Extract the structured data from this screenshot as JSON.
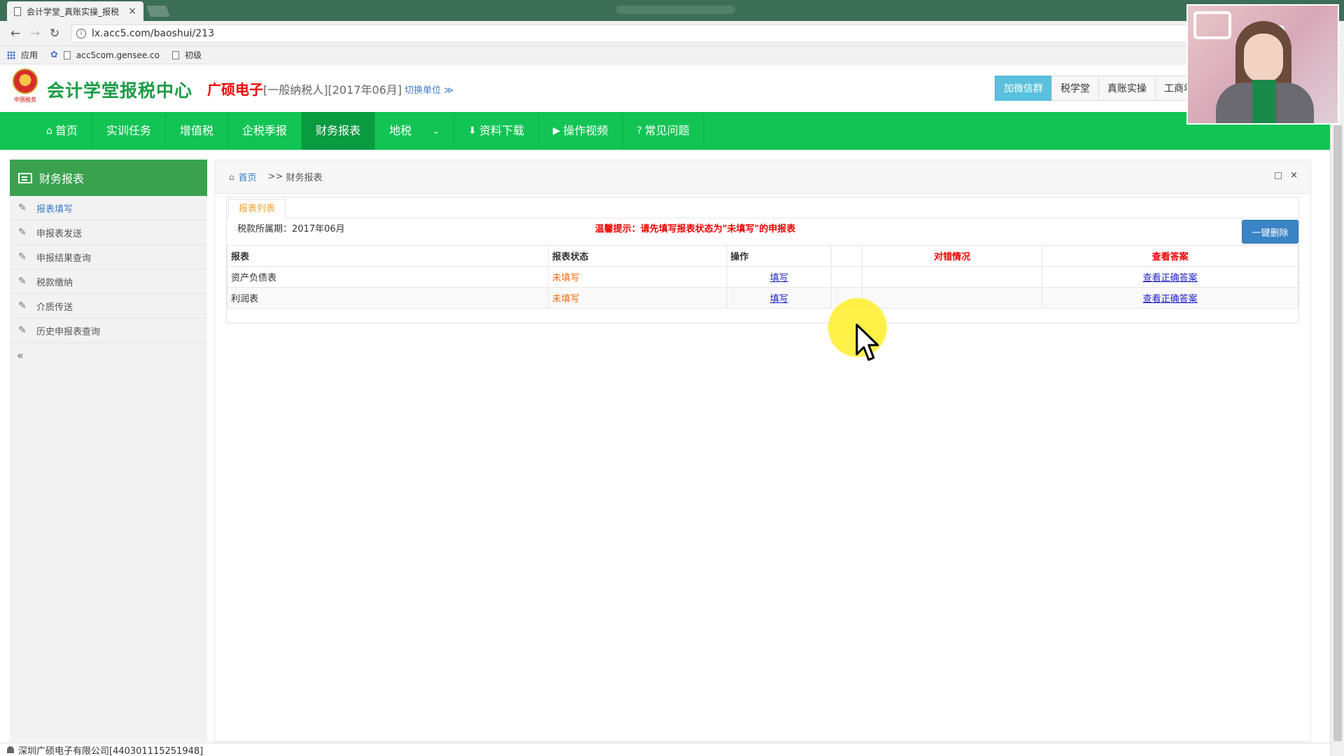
{
  "browser": {
    "tab_title": "会计学堂_真账实操_报税",
    "url": "lx.acc5.com/baoshui/213",
    "bookmarks": [
      {
        "label": "应用"
      },
      {
        "label": "acc5com.gensee.co"
      },
      {
        "label": "初级"
      }
    ]
  },
  "header": {
    "emblem_text": "中国税务",
    "site_title": "会计学堂报税中心",
    "company": "广硕电子",
    "taxpayer_info": "[一般纳税人][2017年06月]",
    "switch_unit": "切换单位 ≫",
    "top_links": [
      "加微信群",
      "税学堂",
      "真账实操",
      "工商年"
    ]
  },
  "nav": {
    "items": [
      {
        "label": "首页",
        "icon": "home-icon",
        "glyph": "⌂"
      },
      {
        "label": "实训任务"
      },
      {
        "label": "增值税"
      },
      {
        "label": "企税季报"
      },
      {
        "label": "财务报表",
        "active": true
      },
      {
        "label": "地税",
        "caret": "⌄"
      },
      {
        "label": "资料下载",
        "icon": "download-icon",
        "glyph": "⬇"
      },
      {
        "label": "操作视频",
        "icon": "play-icon",
        "glyph": "▶"
      },
      {
        "label": "常见问题",
        "icon": "question-icon",
        "glyph": "?"
      }
    ]
  },
  "sidebar": {
    "title": "财务报表",
    "items": [
      {
        "label": "报表填写",
        "active": true
      },
      {
        "label": "申报表发送"
      },
      {
        "label": "申报结果查询"
      },
      {
        "label": "税款缴纳"
      },
      {
        "label": "介质传送"
      },
      {
        "label": "历史申报表查询"
      }
    ],
    "collapse_glyph": "«"
  },
  "breadcrumb": {
    "home": "首页",
    "separator": ">>",
    "current": "财务报表"
  },
  "panel": {
    "tab_label": "报表列表",
    "period": "税款所属期：2017年06月",
    "tip": "温馨提示：请先填写报表状态为\"未填写\"的申报表",
    "delete_button": "一键删除",
    "columns": [
      "报表",
      "报表状态",
      "操作",
      "",
      "对错情况",
      "查看答案"
    ],
    "rows": [
      {
        "name": "资产负债表",
        "status": "未填写",
        "action": "填写",
        "blank": "",
        "result": "",
        "answer": "查看正确答案"
      },
      {
        "name": "利润表",
        "status": "未填写",
        "action": "填写",
        "blank": "",
        "result": "",
        "answer": "查看正确答案"
      }
    ]
  },
  "footer": {
    "company": "深圳广硕电子有限公司[440301115251948]"
  },
  "colors": {
    "nav_green": "#11c454",
    "nav_active": "#0a9a40",
    "sidebar_header": "#3aa24f",
    "title_green": "#1c9c46",
    "status_orange": "#f06a10",
    "tip_red": "#ee0000",
    "link_blue": "#2020c8",
    "button_blue": "#3a83c5"
  }
}
